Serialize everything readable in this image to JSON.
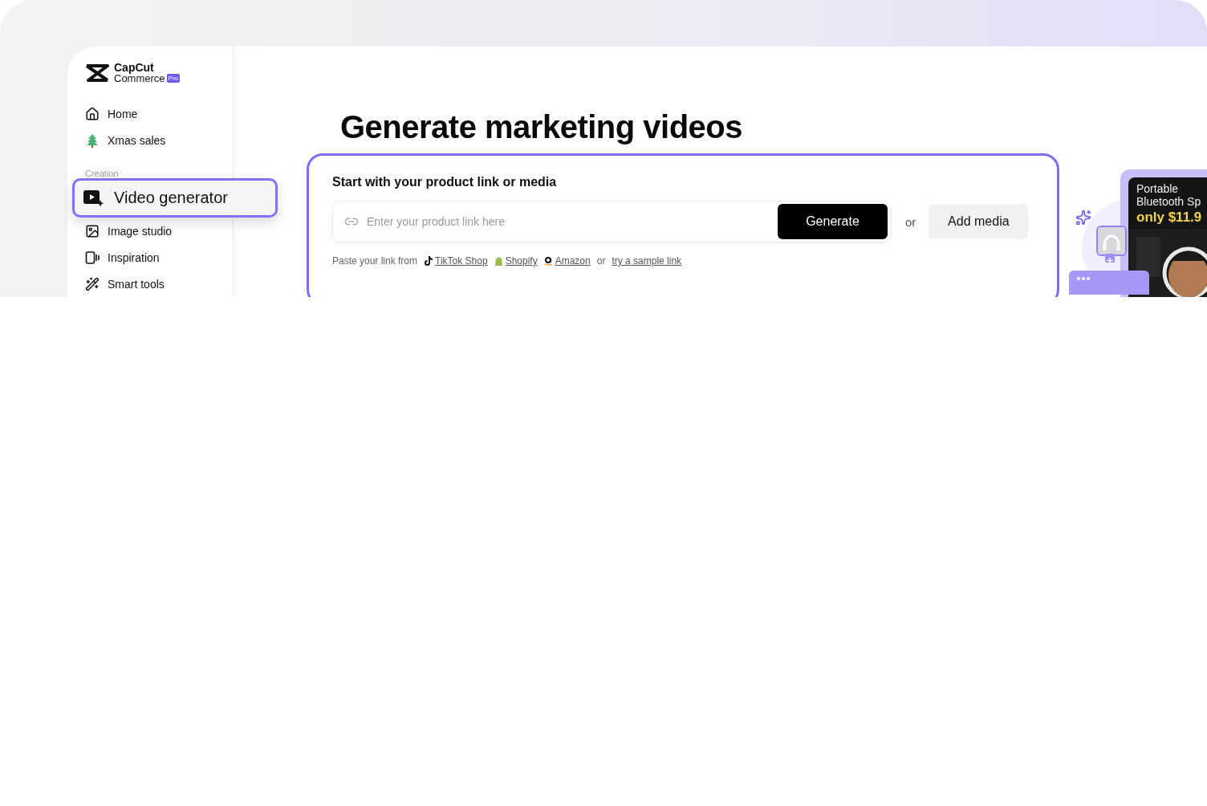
{
  "brand": {
    "name": "CapCut",
    "product": "Commerce",
    "badge": "Pro"
  },
  "sidebar": {
    "items": [
      {
        "label": "Home",
        "selected": false
      },
      {
        "label": "Xmas sales",
        "selected": false
      }
    ],
    "section": "Creation",
    "creation_items": [
      {
        "label": "Video generator",
        "selected": true
      },
      {
        "label": "Image studio",
        "selected": false
      },
      {
        "label": "Inspiration",
        "selected": false
      },
      {
        "label": "Smart tools",
        "selected": false
      }
    ]
  },
  "heading": "Generate marketing videos",
  "card": {
    "title": "Start with your product link or media",
    "placeholder": "Enter your product link here",
    "generate": "Generate",
    "or": "or",
    "add_media": "Add media",
    "hint": "Paste your link from",
    "sources": [
      {
        "label": "TikTok Shop"
      },
      {
        "label": "Shopify"
      },
      {
        "label": "Amazon"
      }
    ],
    "or_2": "or",
    "sample": "try a sample link"
  },
  "preview": {
    "lines": [
      "Portable",
      "Bluetooth Sp"
    ],
    "price": "only $11.9"
  }
}
